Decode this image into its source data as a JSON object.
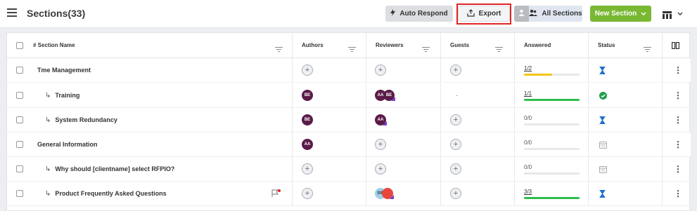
{
  "header": {
    "title": "Sections(33)",
    "auto_respond_label": "Auto Respond",
    "export_label": "Export",
    "all_sections_label": "All Sections",
    "new_section_label": "New Section"
  },
  "table": {
    "columns": [
      "# Section Name",
      "Authors",
      "Reviewers",
      "Guests",
      "Answered",
      "Status"
    ],
    "rows": [
      {
        "name": "Tme Management",
        "sub": false,
        "author": "",
        "reviewers": [],
        "guest": "plus",
        "answered": "1/2",
        "progress": 0.5,
        "bar_color": "#f5c518",
        "status": "in-progress"
      },
      {
        "name": "Training",
        "sub": true,
        "author": "BE",
        "reviewers": [
          "AA",
          "BE"
        ],
        "guest": "dash",
        "answered": "1/1",
        "progress": 1.0,
        "bar_color": "#2dbd4e",
        "status": "complete"
      },
      {
        "name": "System Redundancy",
        "sub": true,
        "author": "BE",
        "reviewers": [
          "AA"
        ],
        "guest": "plus",
        "answered": "0/0",
        "progress": 0,
        "bar_color": "#2dbd4e",
        "status": "in-progress"
      },
      {
        "name": "General Information",
        "sub": false,
        "author": "AA",
        "reviewers": [],
        "guest": "plus",
        "answered": "0/0",
        "progress": 0,
        "bar_color": "#2dbd4e",
        "status": "not-started"
      },
      {
        "name": "Why should [clientname] select RFPIO?",
        "sub": true,
        "author": "",
        "reviewers": [],
        "guest": "plus",
        "answered": "0/0",
        "progress": 0,
        "bar_color": "#2dbd4e",
        "status": "not-started"
      },
      {
        "name": "Product Frequently Asked Questions",
        "sub": true,
        "author": "",
        "reviewers": [
          "SW"
        ],
        "guest": "plus",
        "answered": "3/3",
        "progress": 1.0,
        "bar_color": "#2dbd4e",
        "status": "in-progress"
      }
    ]
  },
  "colors": {
    "accent_green": "#7ab833",
    "highlight_red": "#e02424",
    "avatar_purple": "#5b1b48"
  }
}
